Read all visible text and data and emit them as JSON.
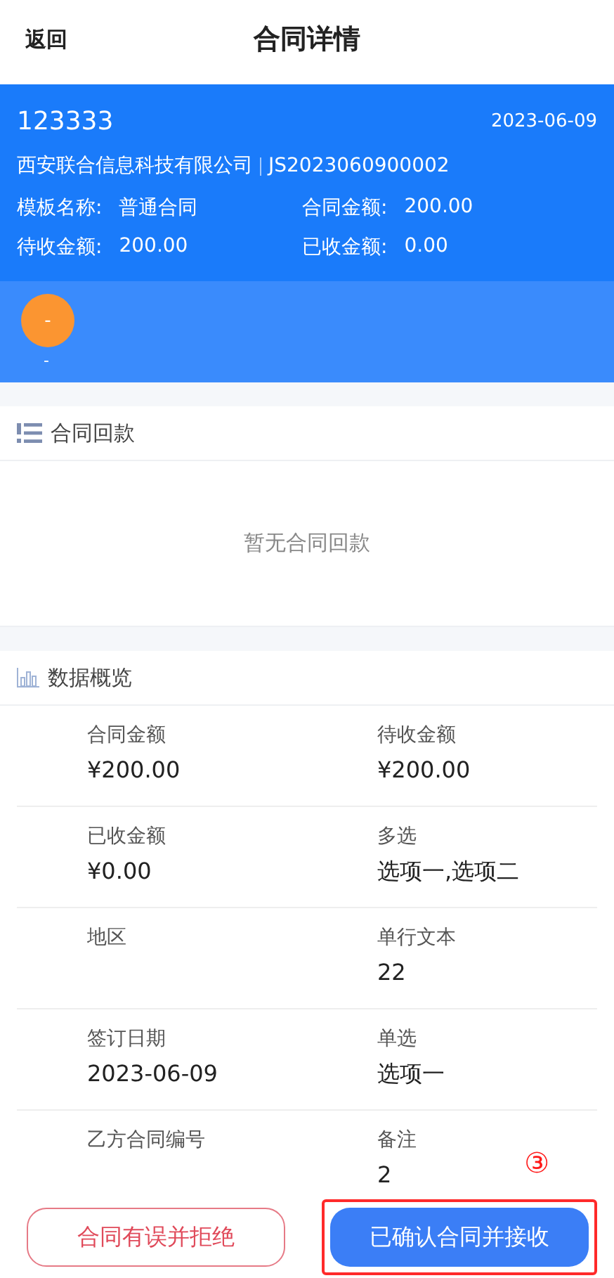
{
  "header": {
    "back": "返回",
    "title": "合同详情"
  },
  "contract": {
    "name": "123333",
    "date": "2023-06-09",
    "company": "西安联合信息科技有限公司",
    "number": "JS2023060900002",
    "fields": [
      {
        "label": "模板名称:",
        "value": "普通合同"
      },
      {
        "label": "合同金额:",
        "value": "200.00"
      },
      {
        "label": "待收金额:",
        "value": "200.00"
      },
      {
        "label": "已收金额:",
        "value": "0.00"
      }
    ],
    "avatar": "-",
    "avatar_caption": "-"
  },
  "payments": {
    "title": "合同回款",
    "empty": "暂无合同回款"
  },
  "overview": {
    "title": "数据概览",
    "items": [
      {
        "label": "合同金额",
        "value": "¥200.00"
      },
      {
        "label": "待收金额",
        "value": "¥200.00"
      },
      {
        "label": "已收金额",
        "value": "¥0.00"
      },
      {
        "label": "多选",
        "value": "选项一,选项二"
      },
      {
        "label": "地区"
      },
      {
        "label": "单行文本",
        "value": "22"
      },
      {
        "label": "签订日期",
        "value": "2023-06-09"
      },
      {
        "label": "单选",
        "value": "选项一"
      },
      {
        "label": "乙方合同编号"
      },
      {
        "label": "备注",
        "value": "2"
      }
    ]
  },
  "buttons": [
    {
      "label": "合同有误并拒绝",
      "kind": "reject"
    },
    {
      "label": "已确认合同并接收",
      "kind": "accept"
    }
  ],
  "annotation": {
    "label": "③"
  }
}
